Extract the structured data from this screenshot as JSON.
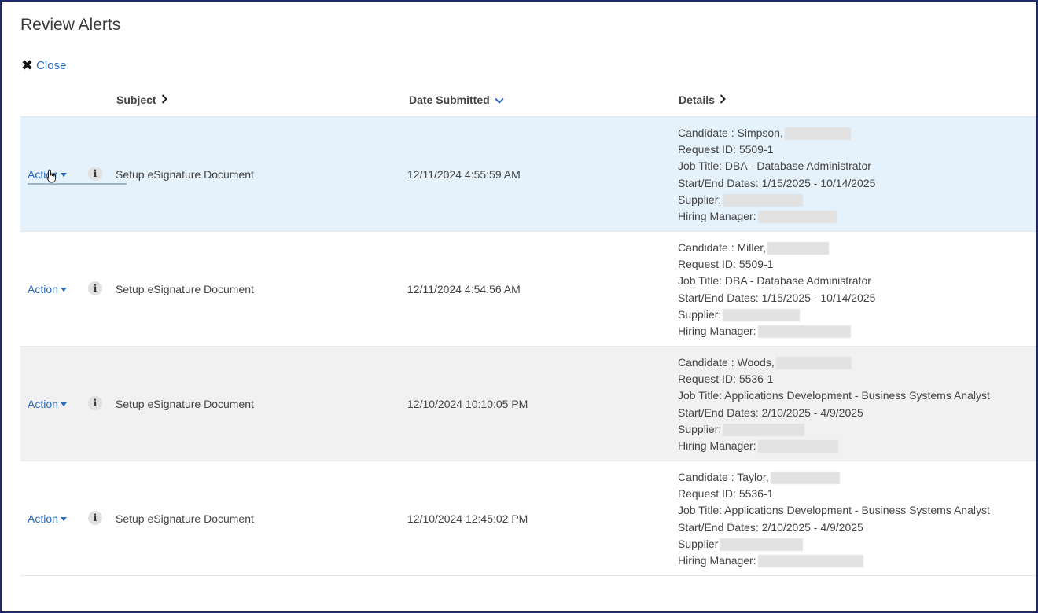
{
  "page": {
    "title": "Review Alerts",
    "close_label": "Close"
  },
  "columns": {
    "subject": "Subject",
    "date": "Date Submitted",
    "details": "Details"
  },
  "colors": {
    "link": "#2a6bbf",
    "highlight_row": "#e5f1fb",
    "alt_row": "#f1f1f1",
    "border": "#1f2a6b"
  },
  "rows": [
    {
      "action": "Action",
      "subject": "Setup eSignature Document",
      "date": "12/11/2024 4:55:59 AM",
      "candidate": "Candidate : Simpson,",
      "request": "Request ID: 5509-1",
      "job": "Job Title: DBA - Database Administrator",
      "dates": "Start/End Dates: 1/15/2025 - 10/14/2025",
      "supplier": "Supplier:",
      "manager": "Hiring Manager:"
    },
    {
      "action": "Action",
      "subject": "Setup eSignature Document",
      "date": "12/11/2024 4:54:56 AM",
      "candidate": "Candidate : Miller,",
      "request": "Request ID: 5509-1",
      "job": "Job Title: DBA - Database Administrator",
      "dates": "Start/End Dates: 1/15/2025 - 10/14/2025",
      "supplier": "Supplier:",
      "manager": "Hiring Manager:"
    },
    {
      "action": "Action",
      "subject": "Setup eSignature Document",
      "date": "12/10/2024 10:10:05 PM",
      "candidate": "Candidate : Woods,",
      "request": "Request ID: 5536-1",
      "job": "Job Title: Applications Development - Business Systems Analyst",
      "dates": "Start/End Dates: 2/10/2025 - 4/9/2025",
      "supplier": "Supplier:",
      "manager": "Hiring Manager:"
    },
    {
      "action": "Action",
      "subject": "Setup eSignature Document",
      "date": "12/10/2024 12:45:02 PM",
      "candidate": "Candidate : Taylor,",
      "request": "Request ID: 5536-1",
      "job": "Job Title: Applications Development - Business Systems Analyst",
      "dates": "Start/End Dates: 2/10/2025 - 4/9/2025",
      "supplier": "Supplier",
      "manager": "Hiring Manager:"
    }
  ]
}
